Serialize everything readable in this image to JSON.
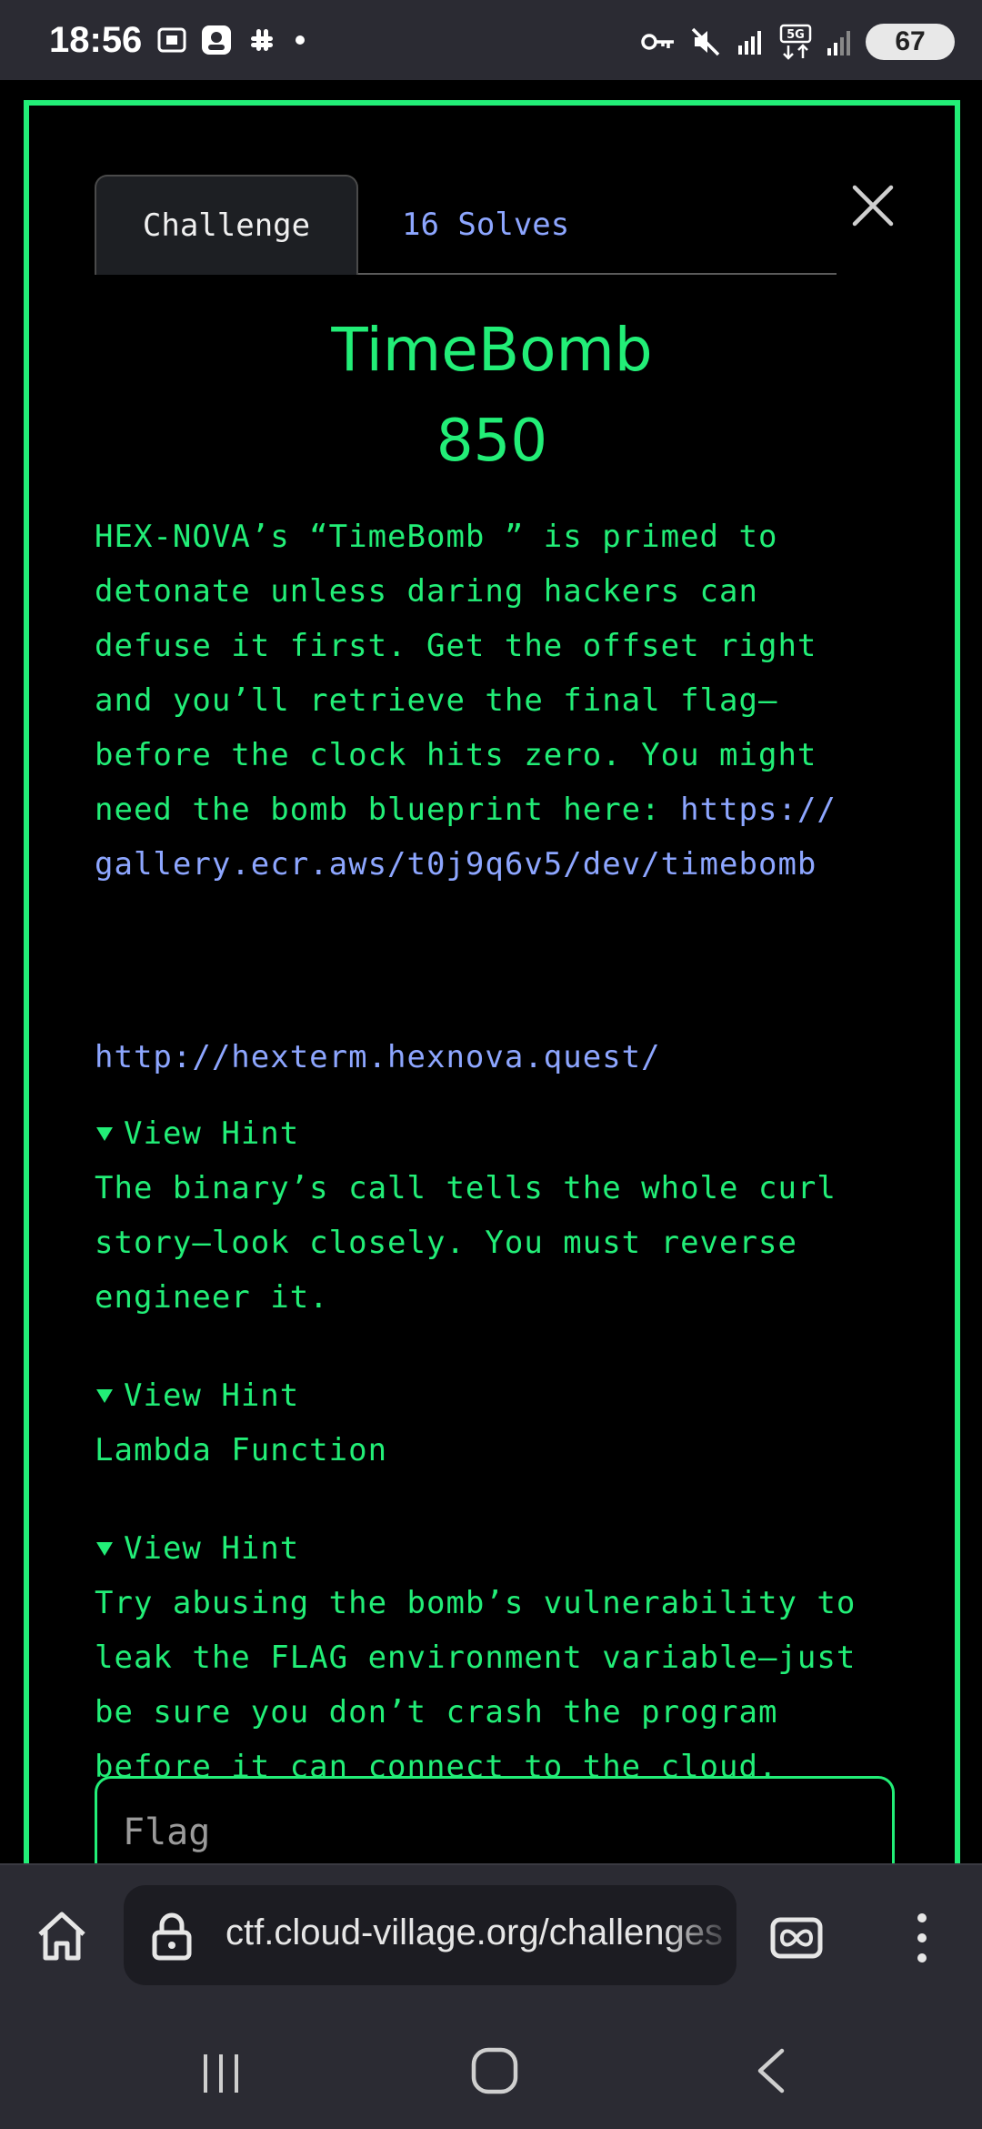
{
  "status_bar": {
    "time": "18:56",
    "battery": "67",
    "network": "5G"
  },
  "colors": {
    "accent_green": "#22ee77",
    "link_blue": "#8da6ff",
    "background": "#000000",
    "chrome": "#2b2b33"
  },
  "modal": {
    "tabs": {
      "challenge": "Challenge",
      "solves": "16 Solves"
    },
    "title": "TimeBomb",
    "points": "850",
    "description": "HEX-NOVA’s “TimeBomb ” is primed to\ndetonate unless daring hackers can\ndefuse it first. Get the offset right\nand you’ll retrieve the final flag—\nbefore the clock hits zero. You might\nneed the bomb blueprint here: ",
    "blueprint_link_1": "https://",
    "blueprint_link_2": "gallery.ecr.aws/t0j9q6v5/dev/timebomb",
    "server_url": "http://hexterm.hexnova.quest/",
    "hints": [
      {
        "summary": "View Hint",
        "text": "The binary’s call tells the whole curl\nstory—look closely. You must reverse\nengineer it."
      },
      {
        "summary": "View Hint",
        "text": "Lambda Function"
      },
      {
        "summary": "View Hint",
        "text": "Try abusing the bomb’s vulnerability to\nleak the FLAG environment variable—just\nbe sure you don’t crash the program\nbefore it can connect to the cloud."
      }
    ],
    "flag_placeholder": "Flag"
  },
  "browser": {
    "url": "ctf.cloud-village.org/challenges"
  },
  "icons": {
    "home": "home-icon",
    "lock": "lock-icon",
    "extension": "infinity-icon",
    "menu": "more-vert-icon",
    "close": "close-icon"
  }
}
